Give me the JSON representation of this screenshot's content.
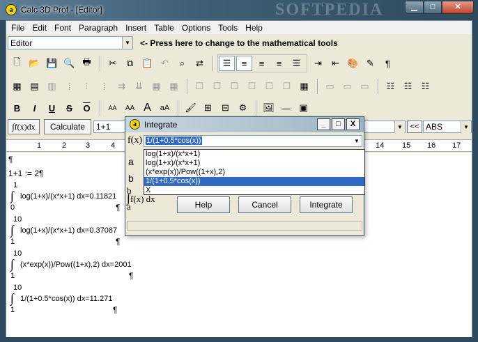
{
  "window": {
    "title": "Calc 3D Prof - [Editor]",
    "watermark": "SOFTPEDIA",
    "app_glyph": "a"
  },
  "menu": [
    "File",
    "Edit",
    "Font",
    "Paragraph",
    "Insert",
    "Table",
    "Options",
    "Tools",
    "Help"
  ],
  "mode": {
    "selected": "Editor",
    "hint": "<- Press here to change to the mathematical tools"
  },
  "calc": {
    "fx_label": "∫f(x)dx",
    "calculate_label": "Calculate",
    "expr": "1+1",
    "nav_label": "<<",
    "func": "ABS"
  },
  "ruler": [
    "1",
    "2",
    "3",
    "4",
    "14",
    "15",
    "16",
    "17"
  ],
  "document": {
    "pilcrow": "¶",
    "line1": "1+1 := 2¶",
    "integrals": [
      {
        "upper": "1",
        "lower": "0",
        "body": "log(1+x)/(x*x+1) dx=0.11821"
      },
      {
        "upper": "10",
        "lower": "1",
        "body": "log(1+x)/(x*x+1) dx=0.37087"
      },
      {
        "upper": "10",
        "lower": "1",
        "body": "(x*exp(x))/Pow((1+x),2) dx=2001"
      },
      {
        "upper": "10",
        "lower": "1",
        "body": "1/(1+0.5*cos(x)) dx=11.271"
      }
    ]
  },
  "dialog": {
    "title": "Integrate",
    "fx": "f(x)",
    "value": "1/(1+0.5*cos(x))",
    "a": "a",
    "b": "b",
    "integral_top": "b",
    "integral_expr": "f(x) dx",
    "integral_bottom": "a",
    "options": [
      "log(1+x)/(x*x+1)",
      "log(1+x)/(x*x+1)",
      "(x*exp(x))/Pow((1+x),2)",
      "1/(1+0.5*cos(x))",
      "X"
    ],
    "active_option": 3,
    "help_label": "Help",
    "cancel_label": "Cancel",
    "integrate_label": "Integrate",
    "min": "_",
    "max": "□",
    "close": "X"
  }
}
